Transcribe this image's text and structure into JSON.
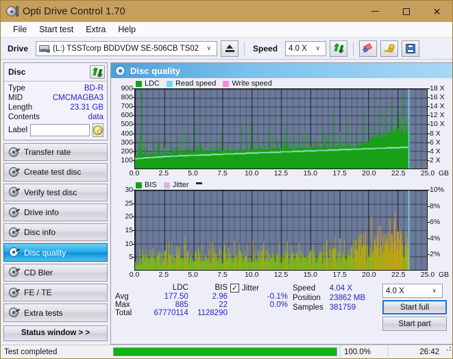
{
  "window": {
    "title": "Opti Drive Control 1.70",
    "app_icon": "disc-drive-icon",
    "minimize": "–",
    "maximize": "□",
    "close": "✕",
    "titlebar_color": "#c79f5c"
  },
  "menu": {
    "items": [
      "File",
      "Start test",
      "Extra",
      "Help"
    ]
  },
  "toolbar": {
    "drive_label": "Drive",
    "drive_value": "(L:)  TSSTcorp BDDVDW SE-506CB TS02",
    "eject_title": "Eject",
    "speed_label": "Speed",
    "speed_value": "4.0 X",
    "refresh_title": "Refresh",
    "erase_title": "Erase",
    "key_title": "Key",
    "save_title": "Save",
    "chevron": "∨"
  },
  "disc_panel": {
    "header": "Disc",
    "refresh_title": "Refresh disc",
    "rows": [
      {
        "key": "Type",
        "value": "BD-R"
      },
      {
        "key": "MID",
        "value": "CMCMAGBA3"
      },
      {
        "key": "Length",
        "value": "23.31 GB"
      },
      {
        "key": "Contents",
        "value": "data"
      }
    ],
    "label_key": "Label",
    "label_value": "",
    "label_placeholder": "",
    "disc_button_title": "Disc label"
  },
  "nav": {
    "items": [
      {
        "label": "Transfer rate",
        "active": false
      },
      {
        "label": "Create test disc",
        "active": false
      },
      {
        "label": "Verify test disc",
        "active": false
      },
      {
        "label": "Drive info",
        "active": false
      },
      {
        "label": "Disc info",
        "active": false
      },
      {
        "label": "Disc quality",
        "active": true
      },
      {
        "label": "CD Bler",
        "active": false
      },
      {
        "label": "FE / TE",
        "active": false
      },
      {
        "label": "Extra tests",
        "active": false
      }
    ],
    "status_window": "Status window > >"
  },
  "panel": {
    "title": "Disc quality",
    "icon": "disc-quality-icon"
  },
  "chart_data": [
    {
      "type": "area",
      "name": "ldc-chart",
      "title": "",
      "xlabel": "GB",
      "ylabel": "",
      "xlim": [
        0.0,
        25.0
      ],
      "ylim": [
        0,
        900
      ],
      "y2lim": [
        0,
        18
      ],
      "y2label": "X",
      "grid": true,
      "legend_position": "top-left",
      "legend": [
        {
          "name": "LDC",
          "color": "#18a018"
        },
        {
          "name": "Read speed",
          "color": "#6fd8f2"
        },
        {
          "name": "Write speed",
          "color": "#f58ae0"
        }
      ],
      "xticks": [
        "0.0",
        "2.5",
        "5.0",
        "7.5",
        "10.0",
        "12.5",
        "15.0",
        "17.5",
        "20.0",
        "22.5",
        "25.0"
      ],
      "yticks": [
        "100",
        "200",
        "300",
        "400",
        "500",
        "600",
        "700",
        "800",
        "900"
      ],
      "y2ticks": [
        "2 X",
        "4 X",
        "6 X",
        "8 X",
        "10 X",
        "12 X",
        "14 X",
        "16 X",
        "18 X"
      ],
      "data_end_gb": 23.4,
      "series": [
        {
          "name": "LDC",
          "color": "#18a018",
          "baseline": [
            150,
            155,
            160,
            158,
            162,
            160,
            165,
            163,
            168,
            166,
            170,
            168,
            172,
            170,
            175,
            172,
            178,
            175,
            180,
            178,
            182,
            180,
            185,
            182,
            186,
            184,
            188,
            186,
            190,
            188,
            192,
            190,
            194,
            192,
            196,
            194,
            198,
            196,
            200,
            198,
            202,
            200,
            204,
            202,
            206,
            204,
            208,
            206,
            210,
            208,
            212,
            210,
            214,
            212,
            216,
            214,
            218,
            216,
            220,
            218,
            222,
            220,
            224,
            222,
            226,
            224,
            228,
            226,
            230,
            228,
            232,
            230,
            234,
            232,
            236,
            234,
            238,
            236,
            240,
            238,
            242,
            240,
            244,
            242,
            246,
            244,
            248,
            246,
            250,
            248,
            252,
            250,
            254,
            252,
            256,
            254,
            258,
            256,
            260,
            258,
            262,
            260,
            264,
            262,
            266,
            264,
            268,
            266,
            270,
            268,
            272,
            270,
            274,
            272,
            276,
            274,
            278,
            276,
            280,
            278
          ],
          "spikes": [
            {
              "x": 0.55,
              "y": 900
            },
            {
              "x": 0.35,
              "y": 420
            },
            {
              "x": 0.75,
              "y": 330
            },
            {
              "x": 1.6,
              "y": 300
            },
            {
              "x": 2.4,
              "y": 340
            },
            {
              "x": 3.1,
              "y": 300
            },
            {
              "x": 4.0,
              "y": 480
            },
            {
              "x": 4.35,
              "y": 360
            },
            {
              "x": 5.2,
              "y": 520
            },
            {
              "x": 5.6,
              "y": 300
            },
            {
              "x": 6.5,
              "y": 330
            },
            {
              "x": 7.4,
              "y": 430
            },
            {
              "x": 8.3,
              "y": 300
            },
            {
              "x": 9.1,
              "y": 490
            },
            {
              "x": 9.9,
              "y": 530
            },
            {
              "x": 10.5,
              "y": 320
            },
            {
              "x": 11.4,
              "y": 450
            },
            {
              "x": 12.1,
              "y": 330
            },
            {
              "x": 12.9,
              "y": 500
            },
            {
              "x": 13.6,
              "y": 360
            },
            {
              "x": 14.5,
              "y": 420
            },
            {
              "x": 15.3,
              "y": 340
            },
            {
              "x": 16.1,
              "y": 480
            },
            {
              "x": 16.9,
              "y": 620
            },
            {
              "x": 17.5,
              "y": 420
            },
            {
              "x": 18.2,
              "y": 560
            },
            {
              "x": 18.9,
              "y": 440
            },
            {
              "x": 19.6,
              "y": 640
            },
            {
              "x": 20.2,
              "y": 520
            },
            {
              "x": 20.8,
              "y": 700
            },
            {
              "x": 21.3,
              "y": 640
            },
            {
              "x": 21.9,
              "y": 760
            },
            {
              "x": 22.4,
              "y": 660
            },
            {
              "x": 22.8,
              "y": 885
            },
            {
              "x": 23.1,
              "y": 700
            }
          ]
        },
        {
          "name": "Read speed",
          "color": "#9fe8f5",
          "units": "X",
          "points": [
            {
              "x": 0.0,
              "y": 2.2
            },
            {
              "x": 2.0,
              "y": 2.6
            },
            {
              "x": 4.0,
              "y": 2.9
            },
            {
              "x": 6.0,
              "y": 3.1
            },
            {
              "x": 8.0,
              "y": 3.3
            },
            {
              "x": 10.0,
              "y": 3.5
            },
            {
              "x": 12.0,
              "y": 3.7
            },
            {
              "x": 14.0,
              "y": 3.9
            },
            {
              "x": 16.0,
              "y": 4.1
            },
            {
              "x": 18.0,
              "y": 4.3
            },
            {
              "x": 20.0,
              "y": 4.5
            },
            {
              "x": 22.0,
              "y": 4.7
            },
            {
              "x": 23.3,
              "y": 4.8
            }
          ]
        }
      ],
      "cursor": {
        "x": 23.4,
        "color": "#79e2f5"
      }
    },
    {
      "type": "bar",
      "name": "bis-chart",
      "title": "",
      "xlabel": "GB",
      "ylabel": "",
      "xlim": [
        0.0,
        25.0
      ],
      "ylim": [
        0,
        30
      ],
      "y2lim": [
        0,
        10
      ],
      "y2label": "%",
      "grid": true,
      "legend_position": "top-left",
      "legend": [
        {
          "name": "BIS",
          "color": "#18a018"
        },
        {
          "name": "Jitter",
          "color": "#d8b8e0"
        }
      ],
      "xticks": [
        "0.0",
        "2.5",
        "5.0",
        "7.5",
        "10.0",
        "12.5",
        "15.0",
        "17.5",
        "20.0",
        "22.5",
        "25.0"
      ],
      "yticks": [
        "5",
        "10",
        "15",
        "20",
        "25",
        "30"
      ],
      "y2ticks": [
        "2%",
        "4%",
        "6%",
        "8%",
        "10%"
      ],
      "data_end_gb": 23.4,
      "series": [
        {
          "name": "BIS",
          "color_low": "#4fc020",
          "color_high": "#e09b10",
          "mean_profile": [
            {
              "x": 0.0,
              "y": 4.5
            },
            {
              "x": 1.0,
              "y": 5.0
            },
            {
              "x": 2.0,
              "y": 5.6
            },
            {
              "x": 4.0,
              "y": 5.8
            },
            {
              "x": 6.0,
              "y": 5.8
            },
            {
              "x": 8.0,
              "y": 5.9
            },
            {
              "x": 10.0,
              "y": 6.2
            },
            {
              "x": 12.0,
              "y": 6.0
            },
            {
              "x": 14.0,
              "y": 6.1
            },
            {
              "x": 16.0,
              "y": 6.3
            },
            {
              "x": 18.0,
              "y": 6.8
            },
            {
              "x": 19.5,
              "y": 8.0
            },
            {
              "x": 20.5,
              "y": 10.5
            },
            {
              "x": 21.5,
              "y": 11.5
            },
            {
              "x": 22.5,
              "y": 12.5
            },
            {
              "x": 23.3,
              "y": 12.0
            }
          ],
          "max": 22
        }
      ],
      "cursor": {
        "x": 23.4,
        "color": "#79e2f5"
      }
    }
  ],
  "stats": {
    "headers": [
      "",
      "LDC",
      "BIS"
    ],
    "rows": [
      {
        "label": "Avg",
        "ldc": "177.50",
        "bis": "2.96"
      },
      {
        "label": "Max",
        "ldc": "885",
        "bis": "22"
      },
      {
        "label": "Total",
        "ldc": "67770114",
        "bis": "1128290"
      }
    ],
    "jitter": {
      "checked": true,
      "check_glyph": "✓",
      "label": "Jitter",
      "values": [
        "-0.1%",
        "0.0%"
      ]
    },
    "speed": {
      "key": "Speed",
      "value": "4.04 X"
    },
    "position": {
      "key": "Position",
      "value": "23862 MB"
    },
    "samples": {
      "key": "Samples",
      "value": "381759"
    },
    "speed_select": "4.0 X",
    "start_full": "Start full",
    "start_part": "Start part"
  },
  "statusbar": {
    "message": "Test completed",
    "progress_percent": 100.0,
    "progress_text": "100.0%",
    "elapsed": "26:42",
    "progress_color": "#12b212"
  }
}
